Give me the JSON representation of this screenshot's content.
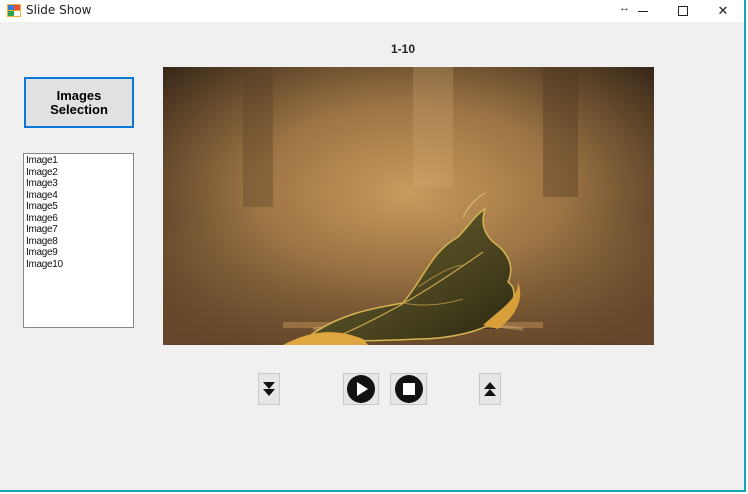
{
  "window": {
    "title": "Slide Show",
    "icons": [
      "slideshow-app-icon",
      "resize-arrows-icon",
      "minimize-icon",
      "maximize-icon",
      "close-icon"
    ]
  },
  "counter": "1-10",
  "select_button": {
    "label": "Images\nSelection"
  },
  "image_list": {
    "items": [
      "Image1",
      "Image2",
      "Image3",
      "Image4",
      "Image5",
      "Image6",
      "Image7",
      "Image8",
      "Image9",
      "Image10"
    ]
  },
  "viewer": {
    "image_subject": "dry autumn leaf on pavement"
  },
  "controls": {
    "icons": [
      "next-down-arrow-icon",
      "play-icon",
      "stop-icon",
      "previous-up-arrow-icon"
    ]
  },
  "colors": {
    "accent": "#0a78d7",
    "window_border": "#18a3b9",
    "background": "#f0f0f0"
  }
}
